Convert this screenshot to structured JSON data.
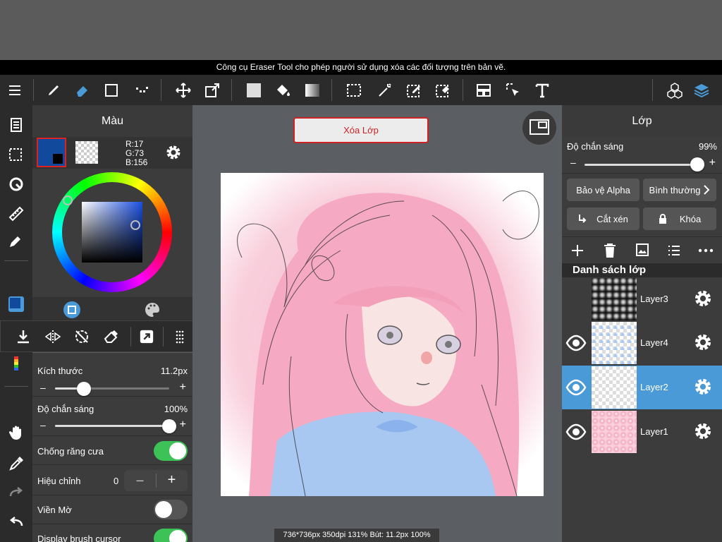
{
  "caption": "Công cụ Eraser Tool cho phép người sử dụng xóa các đối tượng trên bản vẽ.",
  "colors": {
    "accent": "#4a9ad8",
    "toggle_on": "#3cc257",
    "current_color": "#11499c",
    "delete_layer_text": "#cc2222"
  },
  "toolbar_icons": [
    "menu-icon",
    "brush-icon",
    "eraser-icon",
    "rectangle-icon",
    "dot-brush-icon",
    "move-icon",
    "transform-icon",
    "fill-color-icon",
    "bucket-icon",
    "gradient-icon",
    "select-rect-icon",
    "magic-wand-icon",
    "select-pen-icon",
    "select-eraser-icon",
    "layout-icon",
    "select-arrow-icon",
    "text-icon",
    "materials-icon",
    "layers-icon"
  ],
  "color_panel": {
    "title": "Màu",
    "rgb_r": "R:17",
    "rgb_g": "G:73",
    "rgb_b": "B:156"
  },
  "canvas": {
    "delete_layer_button": "Xóa Lớp",
    "status": "736*736px 350dpi 131% Bút: 11.2px 100%"
  },
  "layer_panel": {
    "title": "Lớp",
    "opacity_label": "Độ chắn sáng",
    "opacity_value": "99%",
    "opacity": 0.99,
    "alpha_protect": "Bảo vệ Alpha",
    "blend_mode": "Bình thường",
    "clipping": "Cắt xén",
    "lock": "Khóa",
    "list_title": "Danh sách lớp",
    "layers": [
      {
        "name": "Layer3",
        "visible": false,
        "selected": false
      },
      {
        "name": "Layer4",
        "visible": true,
        "selected": false
      },
      {
        "name": "Layer2",
        "visible": true,
        "selected": true
      },
      {
        "name": "Layer1",
        "visible": true,
        "selected": false
      }
    ]
  },
  "brush_panel": {
    "size_label": "Kích thước",
    "size_value": "11.2px",
    "size_fraction": 0.25,
    "opacity_label": "Độ chắn sáng",
    "opacity_value": "100%",
    "opacity_fraction": 1.0,
    "antialias_label": "Chống răng cưa",
    "antialias_on": true,
    "correction_label": "Hiệu chỉnh",
    "correction_value": "0",
    "soft_edge_label": "Viền Mờ",
    "soft_edge_on": false,
    "cursor_label": "Display brush cursor",
    "cursor_on": true
  }
}
